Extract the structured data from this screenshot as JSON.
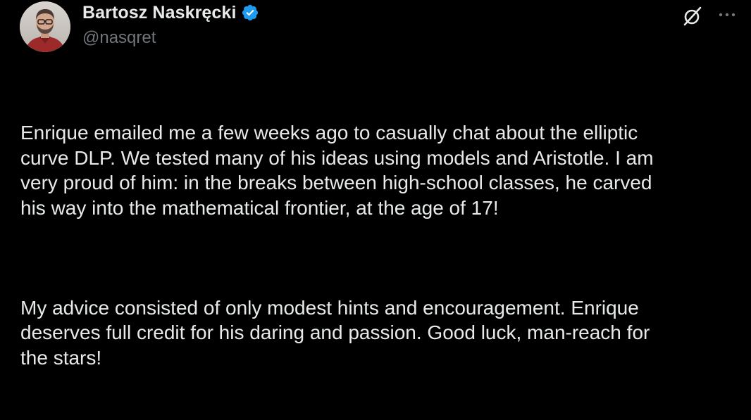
{
  "author": {
    "display_name": "Bartosz Naskręcki",
    "handle": "@nasqret",
    "verified": true,
    "verified_color": "#1d9bf0"
  },
  "actions": {
    "grok_icon": "grok-icon",
    "more_icon": "more-horizontal-icon"
  },
  "post": {
    "paragraphs": [
      "Enrique emailed me a few weeks ago to casually chat about the elliptic\ncurve DLP. We tested many of his ideas using models and Aristotle. I am\nvery proud of him: in the breaks between high-school classes, he carved\nhis way into the mathematical frontier, at the age of 17!",
      "My advice consisted of only modest hints and encouragement. Enrique\ndeserves full credit for his daring and passion. Good luck, man-reach for\nthe stars!"
    ]
  },
  "colors": {
    "background": "#000000",
    "text_primary": "#e7e9ea",
    "text_secondary": "#71767b"
  }
}
